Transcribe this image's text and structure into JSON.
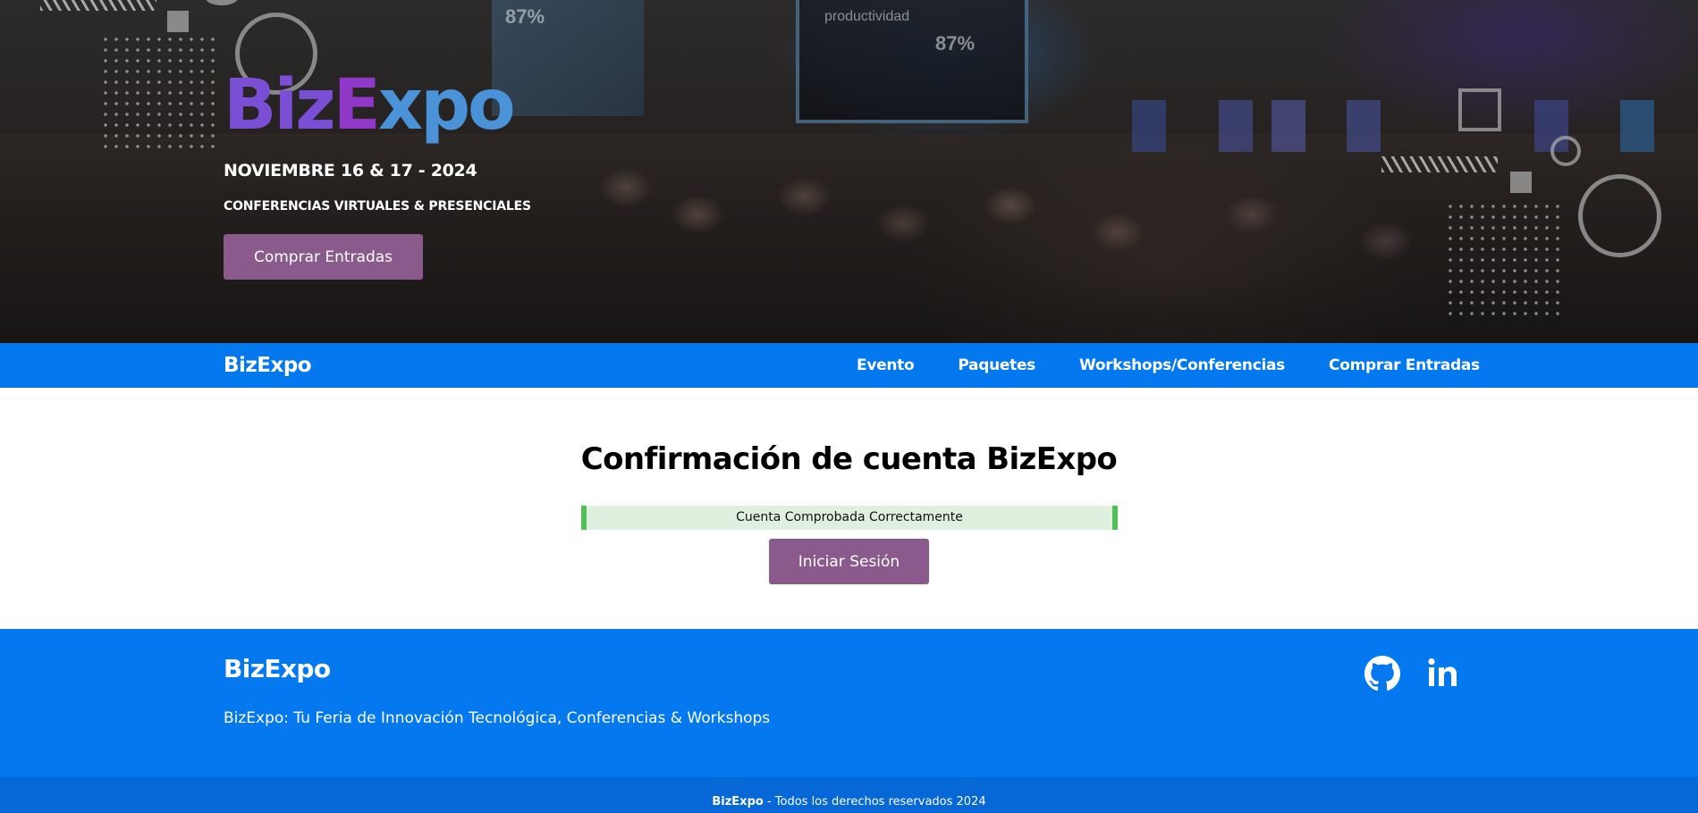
{
  "hero": {
    "logo_part_1": "Biz",
    "logo_part_2": "E",
    "logo_part_3": "xpo",
    "date": "NOVIEMBRE 16 & 17 - 2024",
    "subtitle": "CONFERENCIAS VIRTUALES & PRESENCIALES",
    "cta_label": "Comprar Entradas",
    "screen_texts": {
      "left_stat": "87%",
      "center_heading": "productividad",
      "center_stat": "87%"
    }
  },
  "navbar": {
    "brand": "BizExpo",
    "links": [
      {
        "label": "Evento"
      },
      {
        "label": "Paquetes"
      },
      {
        "label": "Workshops/Conferencias"
      },
      {
        "label": "Comprar Entradas"
      }
    ]
  },
  "main": {
    "title": "Confirmación de cuenta BizExpo",
    "alert_message": "Cuenta Comprobada Correctamente",
    "login_button_label": "Iniciar Sesión"
  },
  "footer": {
    "brand": "BizExpo",
    "tagline": "BizExpo: Tu Feria de Innovación Tecnológica, Conferencias & Workshops",
    "social": [
      {
        "icon": "github-icon"
      },
      {
        "icon": "linkedin-icon"
      }
    ],
    "copyright_brand": "BizExpo",
    "copyright_text": " - Todos los derechos reservados 2024"
  },
  "colors": {
    "nav_blue": "#0478ee",
    "copyright_blue": "#0568d6",
    "button_purple": "#8a5a8c",
    "alert_green_bg": "#dff0df",
    "alert_green_border": "#52c05a",
    "logo_purple": "#7a4fd6",
    "logo_violet": "#9038c8",
    "logo_blue": "#4a93d8"
  }
}
